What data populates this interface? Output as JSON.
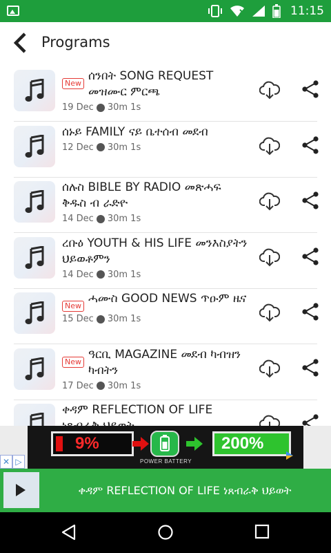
{
  "status_bar": {
    "time": "11:15",
    "icons": [
      "image-icon",
      "vibrate-icon",
      "wifi-icon",
      "cellular-icon",
      "battery-icon"
    ]
  },
  "header": {
    "title": "Programs"
  },
  "programs": [
    {
      "title": "ሰንበት SONG REQUEST መዝሙር ምርጫ",
      "date": "19 Dec",
      "duration": "30m 1s",
      "is_new": true
    },
    {
      "title": "ሰኑይ FAMILY ናይ ቤተሰብ መደብ",
      "date": "12 Dec",
      "duration": "30m 1s",
      "is_new": false
    },
    {
      "title": "ሰሉስ BIBLE BY RADIO መጽሓፍ ቅዱስ ብ ራድዮ",
      "date": "14 Dec",
      "duration": "30m 1s",
      "is_new": false
    },
    {
      "title": "ረቡዕ YOUTH & HIS LIFE መንእስያትን ህይወቶምን",
      "date": "14 Dec",
      "duration": "30m 1s",
      "is_new": false
    },
    {
      "title": "ሓሙስ GOOD NEWS ጥዑም ዜና",
      "date": "15 Dec",
      "duration": "30m 1s",
      "is_new": true
    },
    {
      "title": "ዓርቢ MAGAZINE መደብ ካብዝን ካብትን",
      "date": "17 Dec",
      "duration": "30m 1s",
      "is_new": true
    },
    {
      "title": "ቀዳም REFLECTION OF LIFE ነጸብራቅ ህይወት",
      "date": "",
      "duration": "",
      "is_new": false
    }
  ],
  "new_badge_label": "New",
  "ad": {
    "low_percent": "9%",
    "high_percent": "200%",
    "label": "POWER BATTERY",
    "colors": {
      "low": "#ff2a2a",
      "high": "#2ec32e"
    }
  },
  "promo": {
    "text": "ቀዳም REFLECTION OF LIFE ነጸብራቅ ህይወት"
  },
  "colors": {
    "primary": "#1e9e3c",
    "promo": "#2fad45",
    "new": "#e53935"
  }
}
